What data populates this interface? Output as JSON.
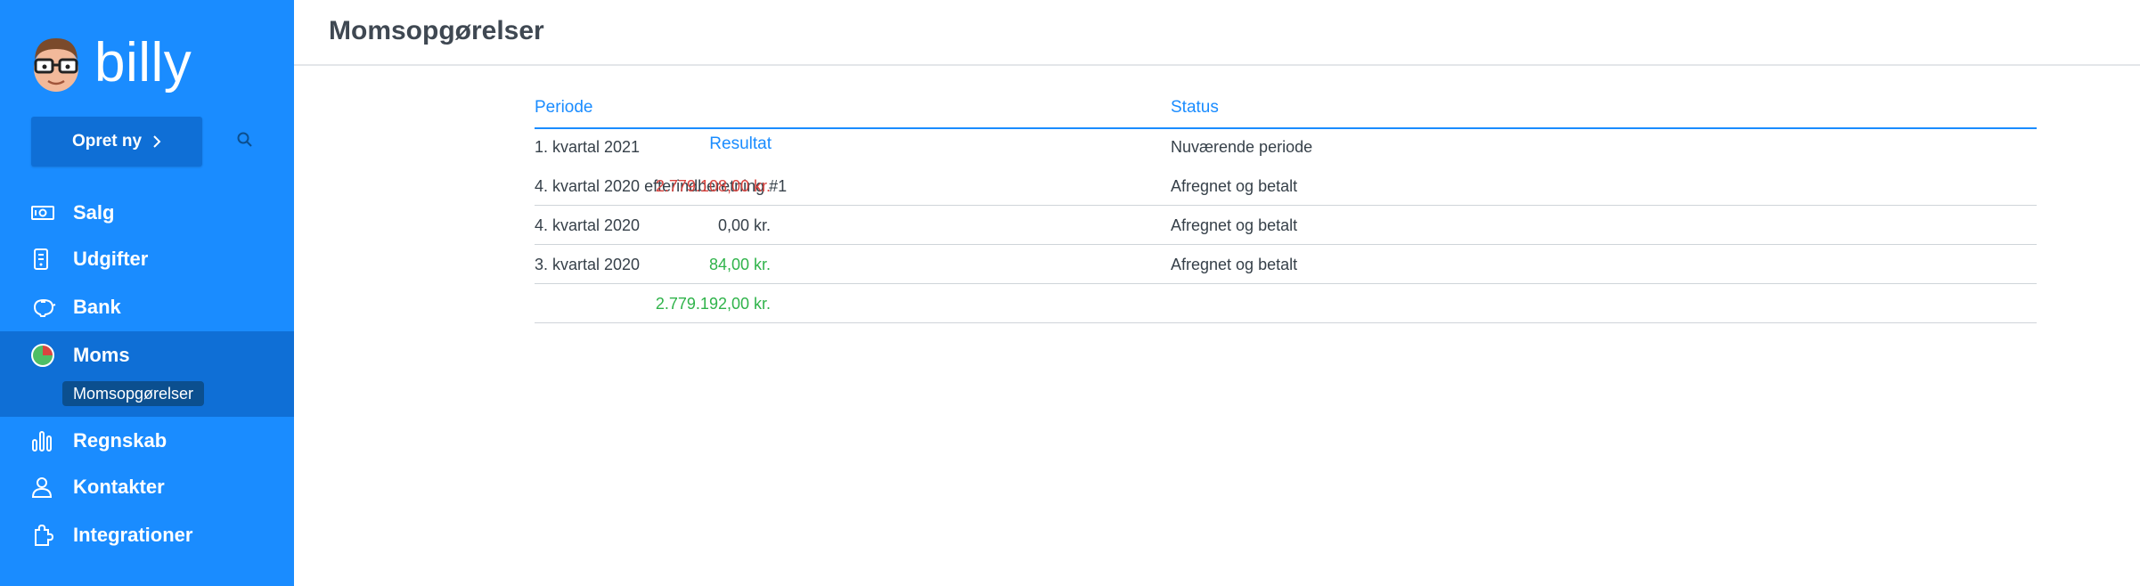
{
  "app": {
    "logo_text": "billy"
  },
  "sidebar": {
    "create_label": "Opret ny",
    "items": [
      {
        "label": "Salg",
        "icon": "cash-icon"
      },
      {
        "label": "Udgifter",
        "icon": "receipt-icon"
      },
      {
        "label": "Bank",
        "icon": "piggy-bank-icon"
      },
      {
        "label": "Moms",
        "icon": "pie-chart-icon"
      },
      {
        "label": "Regnskab",
        "icon": "bar-chart-icon"
      },
      {
        "label": "Kontakter",
        "icon": "user-icon"
      },
      {
        "label": "Integrationer",
        "icon": "puzzle-icon"
      }
    ],
    "active_item": "Moms",
    "sub_item": "Momsopgørelser"
  },
  "header": {
    "title": "Momsopgørelser"
  },
  "table": {
    "columns": {
      "period": "Periode",
      "result": "Resultat",
      "status": "Status"
    },
    "rows": [
      {
        "period": "1. kvartal 2021",
        "result": "",
        "status": "Nuværende periode"
      },
      {
        "period": "4. kvartal 2020 efterindberetning #1",
        "result": "2.779.108,00 kr.",
        "status": "Afregnet og betalt"
      },
      {
        "period": "4. kvartal 2020",
        "result": "0,00 kr.",
        "status": "Afregnet og betalt"
      },
      {
        "period": "3. kvartal 2020",
        "result": "84,00 kr.",
        "status": "Afregnet og betalt"
      }
    ],
    "total": "2.779.192,00 kr."
  },
  "colors": {
    "sidebar": "#1a8cff",
    "active": "#0f6fd6",
    "positive": "#2fb34a",
    "negative": "#d9443f"
  }
}
